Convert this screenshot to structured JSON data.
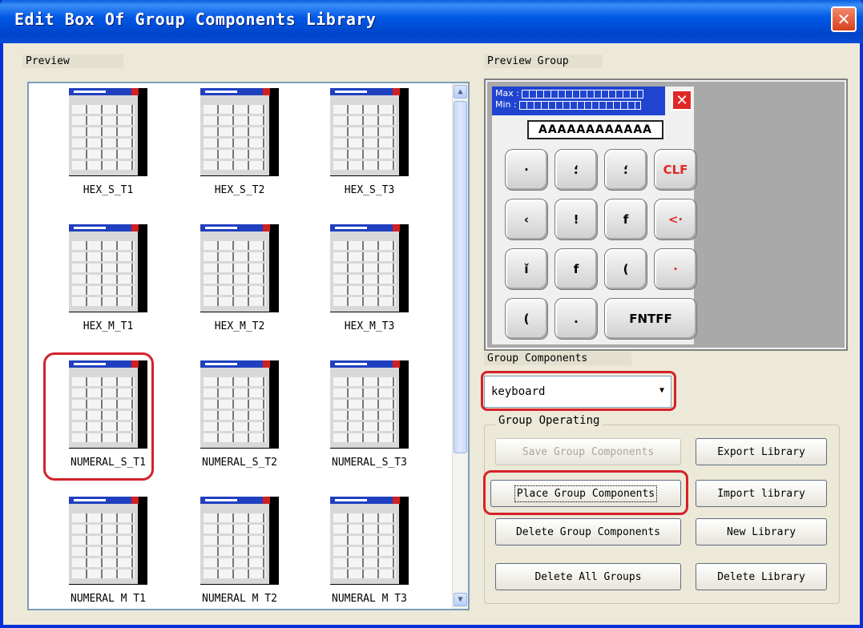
{
  "window": {
    "title": "Edit Box Of Group Components Library"
  },
  "preview": {
    "label": "Preview",
    "thumbnails": [
      {
        "caption": "HEX_S_T1"
      },
      {
        "caption": "HEX_S_T2"
      },
      {
        "caption": "HEX_S_T3"
      },
      {
        "caption": "HEX_M_T1"
      },
      {
        "caption": "HEX_M_T2"
      },
      {
        "caption": "HEX_M_T3"
      },
      {
        "caption": "NUMERAL_S_T1"
      },
      {
        "caption": "NUMERAL_S_T2"
      },
      {
        "caption": "NUMERAL_S_T3"
      },
      {
        "caption": "NUMERAL M T1"
      },
      {
        "caption": "NUMERAL M T2"
      },
      {
        "caption": "NUMERAL M T3"
      }
    ],
    "selected": "NUMERAL_S_T1"
  },
  "preview_group": {
    "label": "Preview Group",
    "max_label": "Max :",
    "min_label": "Min :",
    "display": "AAAAAAAAAAAA",
    "keys": [
      {
        "label": "·",
        "red": false
      },
      {
        "label": "؛",
        "red": false
      },
      {
        "label": "؛",
        "red": false
      },
      {
        "label": "CLF",
        "red": true
      },
      {
        "label": "‹",
        "red": false
      },
      {
        "label": "!",
        "red": false
      },
      {
        "label": "f",
        "red": false
      },
      {
        "label": "<·",
        "red": true
      },
      {
        "label": "ǐ",
        "red": false
      },
      {
        "label": "f",
        "red": false
      },
      {
        "label": "(",
        "red": false
      },
      {
        "label": "·",
        "red": true
      },
      {
        "label": "(",
        "red": false
      },
      {
        "label": ".",
        "red": false
      },
      {
        "label": "FNTFF",
        "red": false
      }
    ]
  },
  "group_components": {
    "label": "Group Components",
    "selected_value": "keyboard"
  },
  "group_operating": {
    "label": "Group Operating",
    "save_label": "Save Group Components",
    "export_label": "Export Library",
    "place_label": "Place Group Components",
    "import_label": "Import library",
    "delete_label": "Delete Group Components",
    "new_label": "New Library",
    "delete_all_label": "Delete All Groups",
    "delete_library_label": "Delete Library"
  },
  "colors": {
    "title_bar": "#0058e6",
    "highlight_ring": "#d4222a",
    "key_red": "#e02828"
  }
}
